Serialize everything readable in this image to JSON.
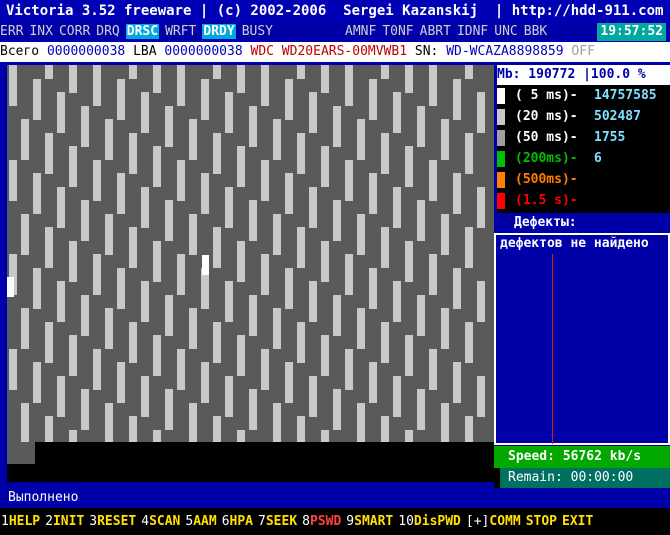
{
  "title": "Victoria 3.52 freeware | (c) 2002-2006  Sergei Kazanskij  | http://hdd-911.com",
  "clock": "19:57:52",
  "flags": [
    {
      "label": "ERR",
      "hl": false
    },
    {
      "label": "INX",
      "hl": false
    },
    {
      "label": "CORR",
      "hl": false
    },
    {
      "label": "DRQ",
      "hl": false
    },
    {
      "label": "DRSC",
      "hl": true
    },
    {
      "label": "WRFT",
      "hl": false
    },
    {
      "label": "DRDY",
      "hl": true
    },
    {
      "label": "BUSY",
      "hl": false
    }
  ],
  "flags_right": [
    "AMNF",
    "T0NF",
    "ABRT",
    "IDNF",
    "UNC",
    "BBK"
  ],
  "info": {
    "total_label": "Всего",
    "total_value": "0000000038",
    "lba_label": "LBA",
    "lba_value": "0000000038",
    "model": "WDC WD20EARS-00MVWB1",
    "sn_label": "SN:",
    "sn_value": "WD-WCAZA8898859",
    "off": "OFF"
  },
  "mb_row": "Mb: 190772 |100.0 %",
  "stats": [
    {
      "label": "( 5 ms)-",
      "value": "14757585",
      "color": "#ffffff"
    },
    {
      "label": "(20 ms)-",
      "value": "502487",
      "color": "#c8c8c8"
    },
    {
      "label": "(50 ms)-",
      "value": "1755",
      "color": "#a0a0a0"
    },
    {
      "label": "(200ms)-",
      "value": "6",
      "color": "#00c000"
    },
    {
      "label": "(500ms)-",
      "value": "",
      "color": "#ff8000"
    },
    {
      "label": "(1.5 s)-",
      "value": "",
      "color": "#ff0000"
    }
  ],
  "defects_title": "Дефекты:",
  "defects_msg": "дефектов не найдено",
  "speed": "Speed: 56762 kb/s",
  "remain": "Remain: 00:00:00",
  "status": "Выполнено",
  "menu": [
    {
      "num": "1",
      "label": "HELP"
    },
    {
      "num": "2",
      "label": "INIT"
    },
    {
      "num": "3",
      "label": "RESET"
    },
    {
      "num": "4",
      "label": "SCAN"
    },
    {
      "num": "5",
      "label": "AAM"
    },
    {
      "num": "6",
      "label": "HPA"
    },
    {
      "num": "7",
      "label": "SEEK"
    },
    {
      "num": "8",
      "label": "PSWD",
      "red": true
    },
    {
      "num": "9",
      "label": "SMART"
    },
    {
      "num": "10",
      "label": "DisPWD"
    },
    {
      "num": "[+]",
      "label": "COMM"
    },
    {
      "num": "",
      "label": "STOP"
    },
    {
      "num": "",
      "label": "EXIT"
    }
  ],
  "colors": {
    "background": "#0000a8",
    "grid": "#5a5a5a",
    "block": "#c8c8c8",
    "highlight": "#00a8e0"
  }
}
